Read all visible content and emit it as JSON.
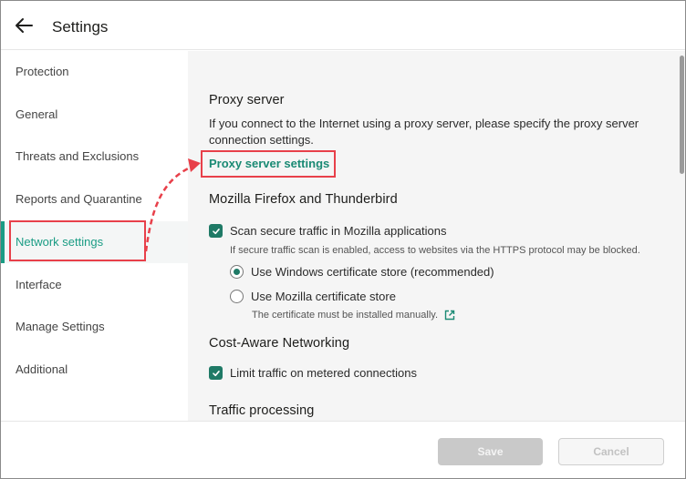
{
  "header": {
    "title": "Settings",
    "back_icon": "arrow-left-icon"
  },
  "sidebar": {
    "items": [
      {
        "label": "Protection",
        "active": false
      },
      {
        "label": "General",
        "active": false
      },
      {
        "label": "Threats and Exclusions",
        "active": false
      },
      {
        "label": "Reports and Quarantine",
        "active": false
      },
      {
        "label": "Network settings",
        "active": true
      },
      {
        "label": "Interface",
        "active": false
      },
      {
        "label": "Manage Settings",
        "active": false
      },
      {
        "label": "Additional",
        "active": false
      }
    ]
  },
  "content": {
    "proxy": {
      "title": "Proxy server",
      "description": "If you connect to the Internet using a proxy server, please specify the proxy server connection settings.",
      "link": "Proxy server settings"
    },
    "mozilla": {
      "title": "Mozilla Firefox and Thunderbird",
      "scan_label": "Scan secure traffic in Mozilla applications",
      "scan_checked": true,
      "scan_note": "If secure traffic scan is enabled, access to websites via the HTTPS protocol may be blocked.",
      "radio_windows": "Use Windows certificate store (recommended)",
      "radio_mozilla": "Use Mozilla certificate store",
      "selected": "windows",
      "mozilla_note": "The certificate must be installed manually."
    },
    "cost": {
      "title": "Cost-Aware Networking",
      "limit_label": "Limit traffic on metered connections",
      "limit_checked": true
    },
    "traffic": {
      "title": "Traffic processing"
    }
  },
  "footer": {
    "save_label": "Save",
    "cancel_label": "Cancel"
  },
  "colors": {
    "accent": "#1a9c84",
    "highlight": "#e8404a",
    "checkbox": "#1f7a66"
  }
}
